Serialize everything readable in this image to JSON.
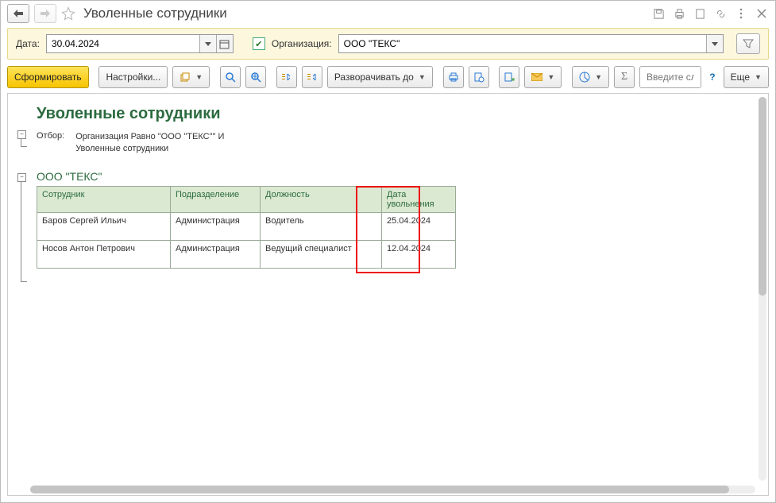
{
  "title": "Уволенные сотрудники",
  "filter": {
    "date_label": "Дата:",
    "date_value": "30.04.2024",
    "org_checked": true,
    "org_label": "Организация:",
    "org_value": "ООО \"ТЕКС\""
  },
  "toolbar": {
    "generate": "Сформировать",
    "settings": "Настройки...",
    "expand": "Разворачивать до",
    "find_placeholder": "Введите сл...",
    "more": "Еще"
  },
  "report": {
    "title": "Уволенные сотрудники",
    "filter_label": "Отбор:",
    "filter_text_1": "Организация Равно \"ООО \"ТЕКС\"\" И",
    "filter_text_2": "Уволенные сотрудники",
    "org_title": "ООО \"ТЕКС\"",
    "columns": {
      "employee": "Сотрудник",
      "department": "Подразделение",
      "position": "Должность",
      "dismissal_date": "Дата увольнения"
    },
    "rows": [
      {
        "employee": "Баров Сергей Ильич",
        "department": "Администрация",
        "position": "Водитель",
        "date": "25.04.2024"
      },
      {
        "employee": "Носов Антон Петрович",
        "department": "Администрация",
        "position": "Ведущий специалист",
        "date": "12.04.2024"
      }
    ]
  }
}
